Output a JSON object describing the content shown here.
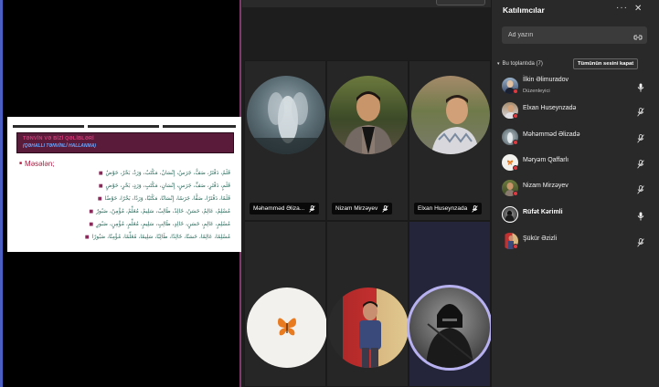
{
  "shared_slide": {
    "title_line1": "TƏNVİN VƏ BİZİ QƏLİBLƏRİ",
    "title_line2": "(QƏHALLI TƏNVİNLİ HALLANMA)",
    "example_label": "Məsələn;",
    "lines": [
      "قَلَمٌ، دَفْتَرٌ، صَفٌّ، جَرَسٌ، إِنْسَانٌ، مَكْتَبٌ، وَرَدٌ، بَحْرٌ، حَوْضٌ",
      "قَلَمٍ، دَفْتَرٍ، صَفٍّ، جَرَسٍ، إِنْسَانٍ، مَكْتَبٍ، وَرَدٍ، بَحْرٍ، حَوْضٍ",
      "قَلَمًا، دَفْتَرًا، صَفًّا، جَرَسًا، إِنْسَانًا، مَكْتَبًا، وَرَدًا، بَحْرًا، حَوْضًا",
      "مُسْلِمٌ، عَالِمٌ، حَسَنٌ، خَالِدٌ، طَالِبٌ، سَلِيمٌ، مُعَلِّمٌ، مُؤْمِنٌ، صَبُورٌ",
      "مُسْلِمٍ، عَالِمٍ، حَسَنٍ، خَالِدٍ، طَالِبٍ، سَلِيمٍ، مُعَلِّمٍ، مُؤْمِنٍ، صَبُورٍ",
      "مُسْلِمًا، عَالِمًا، حَسَنًا، خَالِدًا، طَالِبًا، سَلِيمًا، مُعَلِّمًا، مُؤْمِنًا، صَبُورًا"
    ]
  },
  "video_tiles": [
    {
      "name": "Məhəmməd Əlizadə",
      "tag": "Məhəmməd Əliza...",
      "muted": true,
      "avatar": "avatar-angel-photo"
    },
    {
      "name": "Nizam Mirzəyev",
      "tag": "Nizam Mirzəyev",
      "muted": true,
      "avatar": "avatar-man-photo"
    },
    {
      "name": "Elxan Huseynzadə",
      "tag": "Elxan Huseynzada",
      "muted": true,
      "avatar": "avatar-man-outdoor-photo"
    },
    {
      "name": "Məryəm Qaffarlı",
      "tag": "",
      "muted": true,
      "avatar": "butterfly-icon"
    },
    {
      "name": "Şükür Əzizli",
      "tag": "",
      "muted": true,
      "avatar": "avatar-man-red-door-photo"
    },
    {
      "name": "Rüfət Kərimli",
      "tag": "",
      "muted": false,
      "avatar": "avatar-warrior-photo"
    }
  ],
  "panel": {
    "title": "Katılımcılar",
    "search_placeholder": "Ad yazın",
    "section_label": "Bu toplantıda (7)",
    "mute_all_label": "Tümünün sesini kapat",
    "participants": [
      {
        "name": "İlkin Əlimuradov",
        "role": "Düzenleyici",
        "mic": "on",
        "bold": false
      },
      {
        "name": "Elxan Huseynzadə",
        "role": "",
        "mic": "off",
        "bold": false
      },
      {
        "name": "Məhəmməd Əlizadə",
        "role": "",
        "mic": "off",
        "bold": false
      },
      {
        "name": "Məryəm Qaffarlı",
        "role": "",
        "mic": "off",
        "bold": false
      },
      {
        "name": "Nizam Mirzəyev",
        "role": "",
        "mic": "off",
        "bold": false
      },
      {
        "name": "Rüfət Kərimli",
        "role": "",
        "mic": "on",
        "bold": true
      },
      {
        "name": "Şükür Əzizli",
        "role": "",
        "mic": "off",
        "bold": false
      }
    ]
  },
  "colors": {
    "share_border_left": "#4a5fc1",
    "share_border_right": "#7d3a6a",
    "active_speaker_ring": "#b7b1f0",
    "status_dot": "#e0383f"
  }
}
